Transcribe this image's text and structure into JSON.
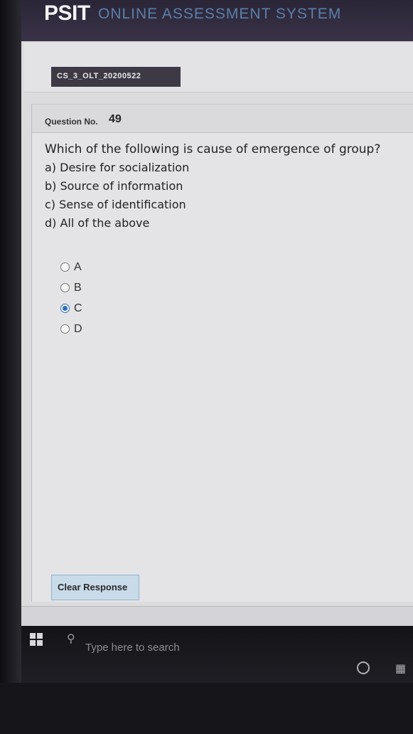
{
  "app": {
    "logo_main": "PSIT",
    "logo_sub": "ONLINE ASSESSMENT SYSTEM"
  },
  "exam": {
    "tag": "CS_3_OLT_20200522"
  },
  "question": {
    "label": "Question No.",
    "number": "49",
    "text": "Which of the following is cause of emergence of group?",
    "options": [
      "a) Desire for socialization",
      "b) Source of information",
      "c) Sense of identification",
      "d) All of the above"
    ]
  },
  "answers": [
    {
      "label": "A",
      "selected": false
    },
    {
      "label": "B",
      "selected": false
    },
    {
      "label": "C",
      "selected": true
    },
    {
      "label": "D",
      "selected": false
    }
  ],
  "actions": {
    "clear_label": "Clear Response"
  },
  "taskbar": {
    "search_placeholder": "Type here to search",
    "icons": [
      "windows-icon",
      "search-icon",
      "cortana-icon",
      "task-view-icon"
    ]
  },
  "colors": {
    "header_bg": "#2b2538",
    "selected_radio": "#2c6fb8",
    "clear_button_bg": "#c9dbe9"
  }
}
